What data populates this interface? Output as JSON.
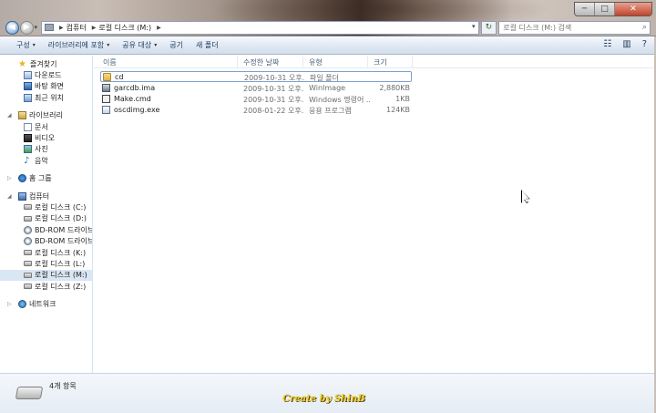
{
  "window": {
    "caption_min": "─",
    "caption_max": "□",
    "caption_close": "✕"
  },
  "nav": {
    "back_glyph": "◀",
    "forward_glyph": "▶",
    "recent_glyph": "▾",
    "breadcrumb": [
      "컴퓨터",
      "로컬 디스크 (M:)"
    ],
    "refresh_glyph": "↻",
    "search_placeholder": "로컬 디스크 (M:) 검색",
    "search_glyph": "⌕"
  },
  "toolbar": {
    "items": [
      {
        "label": "구성",
        "has_menu": true
      },
      {
        "label": "라이브러리에 포함",
        "has_menu": true
      },
      {
        "label": "공유 대상",
        "has_menu": true
      },
      {
        "label": "굽기",
        "has_menu": false
      },
      {
        "label": "새 폴더",
        "has_menu": false
      }
    ],
    "menu_arrow": "▾",
    "view_glyph": "☷",
    "pane_glyph": "▥",
    "help_glyph": "?"
  },
  "sidebar": {
    "favorites": {
      "label": "즐겨찾기",
      "items": [
        "다운로드",
        "바탕 화면",
        "최근 위치"
      ]
    },
    "libraries": {
      "label": "라이브러리",
      "items": [
        "문서",
        "비디오",
        "사진",
        "음악"
      ]
    },
    "homegroup": {
      "label": "홈 그룹"
    },
    "computer": {
      "label": "컴퓨터",
      "items": [
        {
          "label": "로컬 디스크 (C:)",
          "kind": "drive"
        },
        {
          "label": "로컬 디스크 (D:)",
          "kind": "drive"
        },
        {
          "label": "BD-ROM 드라이브 (",
          "kind": "cd"
        },
        {
          "label": "BD-ROM 드라이브 (",
          "kind": "cd"
        },
        {
          "label": "로컬 디스크 (K:)",
          "kind": "drive"
        },
        {
          "label": "로컬 디스크 (L:)",
          "kind": "drive"
        },
        {
          "label": "로컬 디스크 (M:)",
          "kind": "drive",
          "selected": true
        },
        {
          "label": "로컬 디스크 (Z:)",
          "kind": "drive"
        }
      ]
    },
    "network": {
      "label": "네트워크"
    }
  },
  "columns": {
    "name": "이름",
    "date": "수정한 날짜",
    "type": "유형",
    "size": "크기"
  },
  "files": [
    {
      "name": "cd",
      "date": "2009-10-31 오후...",
      "type": "파일 폴더",
      "size": "",
      "icon": "folder-icon",
      "selected": true
    },
    {
      "name": "garcdb.ima",
      "date": "2009-10-31 오후...",
      "type": "WinImage",
      "size": "2,880KB",
      "icon": "disk-image-icon"
    },
    {
      "name": "Make.cmd",
      "date": "2009-10-31 오후...",
      "type": "Windows 명령어 ...",
      "size": "1KB",
      "icon": "script-icon"
    },
    {
      "name": "oscdimg.exe",
      "date": "2008-01-22 오후...",
      "type": "응용 프로그램",
      "size": "124KB",
      "icon": "application-icon"
    }
  ],
  "details": {
    "count": "4개 항목"
  },
  "watermark": "Create by ShinB"
}
